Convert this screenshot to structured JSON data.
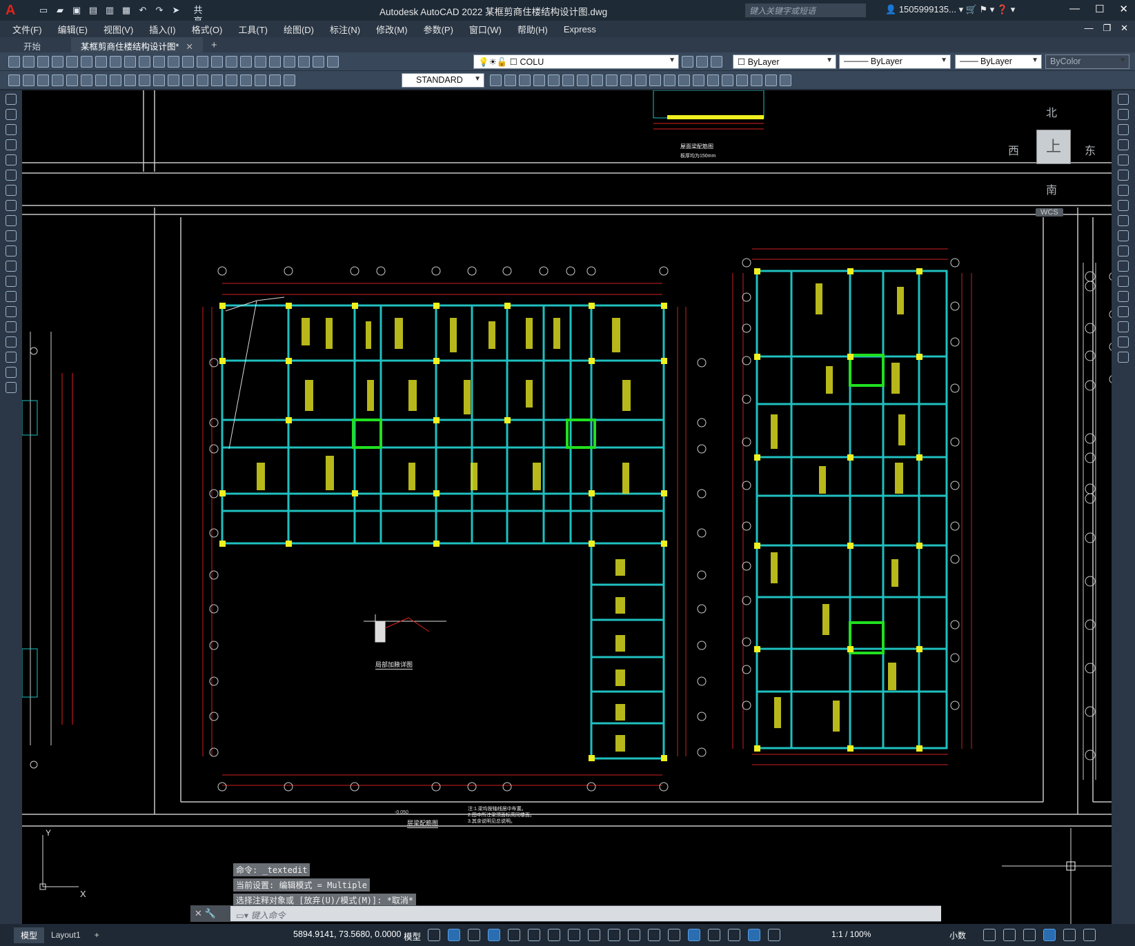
{
  "app": {
    "logo": "A",
    "title": "Autodesk AutoCAD 2022    某框剪商住楼结构设计图.dwg",
    "share": "共享",
    "search_placeholder": "键入关键字或短语",
    "user": "1505999135...",
    "accent": "#e2231a"
  },
  "menu": [
    "文件(F)",
    "编辑(E)",
    "视图(V)",
    "插入(I)",
    "格式(O)",
    "工具(T)",
    "绘图(D)",
    "标注(N)",
    "修改(M)",
    "参数(P)",
    "窗口(W)",
    "帮助(H)",
    "Express"
  ],
  "tabs": [
    {
      "label": "开始"
    },
    {
      "label": "某框剪商住楼结构设计图*"
    }
  ],
  "toolbar": {
    "layer": "COLU",
    "color": "ByLayer",
    "linetype": "ByLayer",
    "lineweight": "ByLayer",
    "plotstyle": "ByColor",
    "textstyle": "STANDARD"
  },
  "viewcube": {
    "north": "北",
    "south": "南",
    "east": "东",
    "west": "西",
    "top": "上",
    "wcs": "WCS"
  },
  "drawing": {
    "ucs_x": "X",
    "ucs_y": "Y",
    "title_main": "层梁配筋图",
    "title_detail": "局部加腋详图",
    "title_top": "屋面梁配筋图",
    "note_top": "板厚均为150mm",
    "elev": "-0.050",
    "notes_main": [
      "注:1.梁均按轴线居中布置。",
      "2.图中所注梁顶面标高同楼面。",
      "3.其余说明见总说明。"
    ]
  },
  "command": {
    "history": [
      "命令: _textedit",
      "当前设置: 编辑模式 = Multiple",
      "选择注释对象或 [放弃(U)/模式(M)]: *取消*"
    ],
    "placeholder": "键入命令"
  },
  "status": {
    "model_tab": "模型",
    "layout_tab": "Layout1",
    "coords": "5894.9141, 73.5680, 0.0000",
    "model_label": "模型",
    "scale": "1:1 / 100%",
    "units": "小数"
  }
}
